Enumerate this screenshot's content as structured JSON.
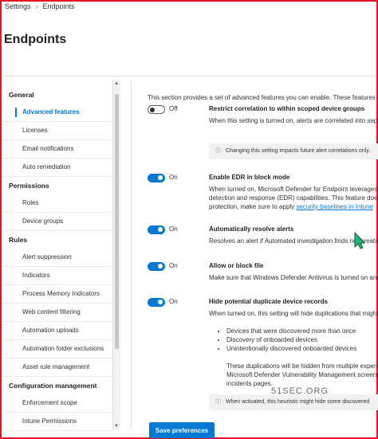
{
  "breadcrumb": {
    "root": "Settings",
    "current": "Endpoints"
  },
  "page_title": "Endpoints",
  "nav": [
    {
      "group": "General",
      "items": [
        {
          "label": "Advanced features",
          "active": true
        },
        {
          "label": "Licenses"
        },
        {
          "label": "Email notifications"
        },
        {
          "label": "Auto remediation"
        }
      ]
    },
    {
      "group": "Permissions",
      "items": [
        {
          "label": "Roles"
        },
        {
          "label": "Device groups"
        }
      ]
    },
    {
      "group": "Rules",
      "items": [
        {
          "label": "Alert suppression"
        },
        {
          "label": "Indicators"
        },
        {
          "label": "Process Memory Indicators"
        },
        {
          "label": "Web content filtering"
        },
        {
          "label": "Automation uploads"
        },
        {
          "label": "Automation folder exclusions"
        },
        {
          "label": "Asset rule management"
        }
      ]
    },
    {
      "group": "Configuration management",
      "items": [
        {
          "label": "Enforcement scope"
        },
        {
          "label": "Intune Permissions"
        }
      ]
    }
  ],
  "intro": "This section provides a set of advanced features you can enable. These features requ",
  "settings": {
    "restrict": {
      "state": "Off",
      "title": "Restrict correlation to within scoped device groups",
      "desc": "When this setting is turned on, alerts are correlated into separ",
      "info": "Changing this setting impacts future alert correlations only."
    },
    "edr": {
      "state": "On",
      "title": "Enable EDR in block mode",
      "desc1": "When turned on, Microsoft Defender for Endpoint leverages b",
      "desc2": "detection and response (EDR) capabilities. This feature does n",
      "desc3_pre": "protection, make sure to apply",
      "desc3_link": "security baselines in Intune"
    },
    "resolve": {
      "state": "On",
      "title": "Automatically resolve alerts",
      "desc": "Resolves an alert if Automated investigation finds no threats"
    },
    "allowblock": {
      "state": "On",
      "title": "Allow or block file",
      "desc": "Make sure that Windows Defender Antivirus is turned on and"
    },
    "duplicates": {
      "state": "On",
      "title": "Hide potential duplicate device records",
      "desc": "When turned on, this setting will hide duplications that might",
      "bullets": [
        "Devices that were discovered more than once",
        "Discovery of onboarded devices",
        "Unintentionally discovered onboarded devices"
      ],
      "note1": "These duplications will be hidden from multiple experi",
      "note2": "Microsoft Defender Vulnerability Management screens,",
      "note3": "incidents pages.",
      "info": "When activated, this heuristic might hide some discovered"
    }
  },
  "save_button": "Save preferences",
  "watermark": "51SEC.ORG",
  "colors": {
    "accent": "#0078d4",
    "frame": "#e81123"
  }
}
